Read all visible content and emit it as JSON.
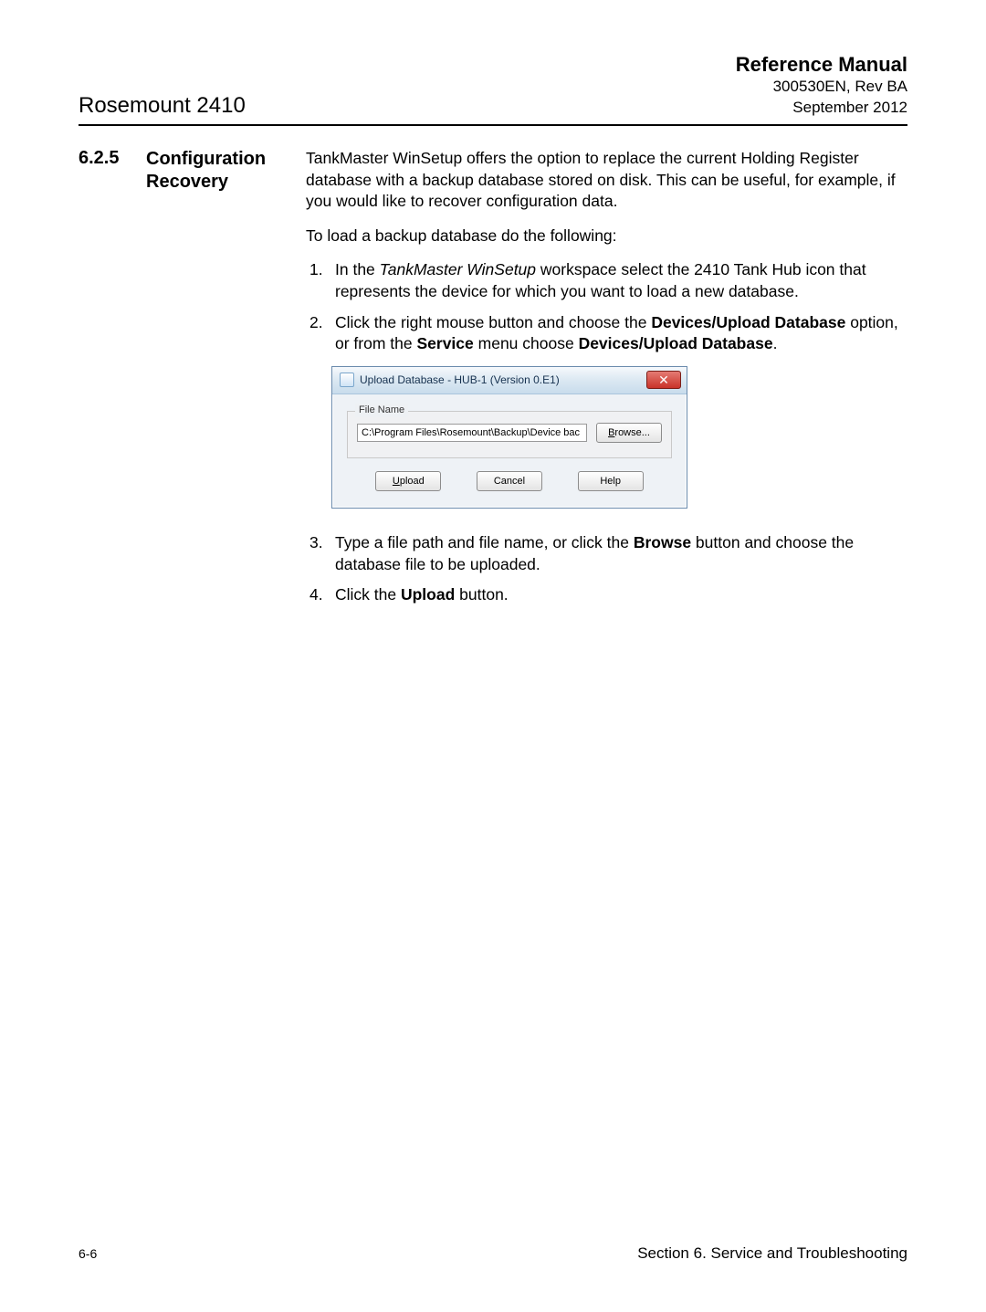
{
  "header": {
    "product": "Rosemount 2410",
    "refTitle": "Reference Manual",
    "docNum": "300530EN, Rev BA",
    "date": "September 2012"
  },
  "section": {
    "number": "6.2.5",
    "title": "Configuration Recovery",
    "intro": "TankMaster WinSetup offers the option to replace the current Holding Register database with a backup database stored on disk. This can be useful, for example, if you would like to recover configuration data.",
    "lead": "To load a backup database do the following:",
    "steps": [
      {
        "num": "1.",
        "pre": "In the ",
        "em": "TankMaster WinSetup",
        "post": " workspace select the 2410 Tank Hub icon that represents the device for which you want to load a new database."
      },
      {
        "num": "2.",
        "t1": "Click the right mouse button and choose the ",
        "b1": "Devices/Upload Database",
        "t2": " option, or from the ",
        "b2": "Service",
        "t3": " menu choose ",
        "b3": "Devices/Upload Database",
        "t4": "."
      },
      {
        "num": "3.",
        "t1": "Type a file path and file name, or click the ",
        "b1": "Browse",
        "t2": " button and choose the database file to be uploaded."
      },
      {
        "num": "4.",
        "t1": "Click the ",
        "b1": "Upload",
        "t2": " button."
      }
    ]
  },
  "dialog": {
    "title": "Upload Database - HUB-1 (Version 0.E1)",
    "legend": "File Name",
    "path": "C:\\Program Files\\Rosemount\\Backup\\Device bac",
    "browse_prefix": "B",
    "browse_rest": "rowse...",
    "upload_prefix": "U",
    "upload_rest": "pload",
    "cancel": "Cancel",
    "help": "Help",
    "close": "✕"
  },
  "footer": {
    "page": "6-6",
    "section": "Section 6. Service and Troubleshooting"
  }
}
